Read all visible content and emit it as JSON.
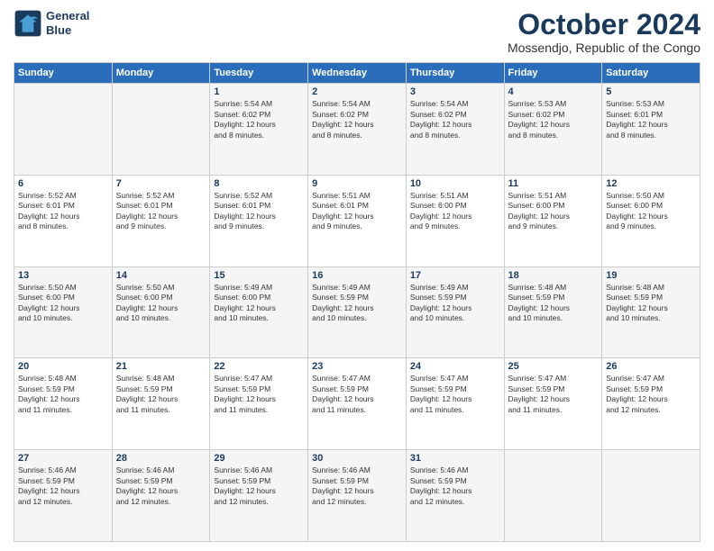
{
  "logo": {
    "line1": "General",
    "line2": "Blue"
  },
  "title": "October 2024",
  "location": "Mossendjo, Republic of the Congo",
  "days_of_week": [
    "Sunday",
    "Monday",
    "Tuesday",
    "Wednesday",
    "Thursday",
    "Friday",
    "Saturday"
  ],
  "weeks": [
    [
      {
        "day": "",
        "info": ""
      },
      {
        "day": "",
        "info": ""
      },
      {
        "day": "1",
        "info": "Sunrise: 5:54 AM\nSunset: 6:02 PM\nDaylight: 12 hours\nand 8 minutes."
      },
      {
        "day": "2",
        "info": "Sunrise: 5:54 AM\nSunset: 6:02 PM\nDaylight: 12 hours\nand 8 minutes."
      },
      {
        "day": "3",
        "info": "Sunrise: 5:54 AM\nSunset: 6:02 PM\nDaylight: 12 hours\nand 8 minutes."
      },
      {
        "day": "4",
        "info": "Sunrise: 5:53 AM\nSunset: 6:02 PM\nDaylight: 12 hours\nand 8 minutes."
      },
      {
        "day": "5",
        "info": "Sunrise: 5:53 AM\nSunset: 6:01 PM\nDaylight: 12 hours\nand 8 minutes."
      }
    ],
    [
      {
        "day": "6",
        "info": "Sunrise: 5:52 AM\nSunset: 6:01 PM\nDaylight: 12 hours\nand 8 minutes."
      },
      {
        "day": "7",
        "info": "Sunrise: 5:52 AM\nSunset: 6:01 PM\nDaylight: 12 hours\nand 9 minutes."
      },
      {
        "day": "8",
        "info": "Sunrise: 5:52 AM\nSunset: 6:01 PM\nDaylight: 12 hours\nand 9 minutes."
      },
      {
        "day": "9",
        "info": "Sunrise: 5:51 AM\nSunset: 6:01 PM\nDaylight: 12 hours\nand 9 minutes."
      },
      {
        "day": "10",
        "info": "Sunrise: 5:51 AM\nSunset: 6:00 PM\nDaylight: 12 hours\nand 9 minutes."
      },
      {
        "day": "11",
        "info": "Sunrise: 5:51 AM\nSunset: 6:00 PM\nDaylight: 12 hours\nand 9 minutes."
      },
      {
        "day": "12",
        "info": "Sunrise: 5:50 AM\nSunset: 6:00 PM\nDaylight: 12 hours\nand 9 minutes."
      }
    ],
    [
      {
        "day": "13",
        "info": "Sunrise: 5:50 AM\nSunset: 6:00 PM\nDaylight: 12 hours\nand 10 minutes."
      },
      {
        "day": "14",
        "info": "Sunrise: 5:50 AM\nSunset: 6:00 PM\nDaylight: 12 hours\nand 10 minutes."
      },
      {
        "day": "15",
        "info": "Sunrise: 5:49 AM\nSunset: 6:00 PM\nDaylight: 12 hours\nand 10 minutes."
      },
      {
        "day": "16",
        "info": "Sunrise: 5:49 AM\nSunset: 5:59 PM\nDaylight: 12 hours\nand 10 minutes."
      },
      {
        "day": "17",
        "info": "Sunrise: 5:49 AM\nSunset: 5:59 PM\nDaylight: 12 hours\nand 10 minutes."
      },
      {
        "day": "18",
        "info": "Sunrise: 5:48 AM\nSunset: 5:59 PM\nDaylight: 12 hours\nand 10 minutes."
      },
      {
        "day": "19",
        "info": "Sunrise: 5:48 AM\nSunset: 5:59 PM\nDaylight: 12 hours\nand 10 minutes."
      }
    ],
    [
      {
        "day": "20",
        "info": "Sunrise: 5:48 AM\nSunset: 5:59 PM\nDaylight: 12 hours\nand 11 minutes."
      },
      {
        "day": "21",
        "info": "Sunrise: 5:48 AM\nSunset: 5:59 PM\nDaylight: 12 hours\nand 11 minutes."
      },
      {
        "day": "22",
        "info": "Sunrise: 5:47 AM\nSunset: 5:59 PM\nDaylight: 12 hours\nand 11 minutes."
      },
      {
        "day": "23",
        "info": "Sunrise: 5:47 AM\nSunset: 5:59 PM\nDaylight: 12 hours\nand 11 minutes."
      },
      {
        "day": "24",
        "info": "Sunrise: 5:47 AM\nSunset: 5:59 PM\nDaylight: 12 hours\nand 11 minutes."
      },
      {
        "day": "25",
        "info": "Sunrise: 5:47 AM\nSunset: 5:59 PM\nDaylight: 12 hours\nand 11 minutes."
      },
      {
        "day": "26",
        "info": "Sunrise: 5:47 AM\nSunset: 5:59 PM\nDaylight: 12 hours\nand 12 minutes."
      }
    ],
    [
      {
        "day": "27",
        "info": "Sunrise: 5:46 AM\nSunset: 5:59 PM\nDaylight: 12 hours\nand 12 minutes."
      },
      {
        "day": "28",
        "info": "Sunrise: 5:46 AM\nSunset: 5:59 PM\nDaylight: 12 hours\nand 12 minutes."
      },
      {
        "day": "29",
        "info": "Sunrise: 5:46 AM\nSunset: 5:59 PM\nDaylight: 12 hours\nand 12 minutes."
      },
      {
        "day": "30",
        "info": "Sunrise: 5:46 AM\nSunset: 5:59 PM\nDaylight: 12 hours\nand 12 minutes."
      },
      {
        "day": "31",
        "info": "Sunrise: 5:46 AM\nSunset: 5:59 PM\nDaylight: 12 hours\nand 12 minutes."
      },
      {
        "day": "",
        "info": ""
      },
      {
        "day": "",
        "info": ""
      }
    ]
  ]
}
